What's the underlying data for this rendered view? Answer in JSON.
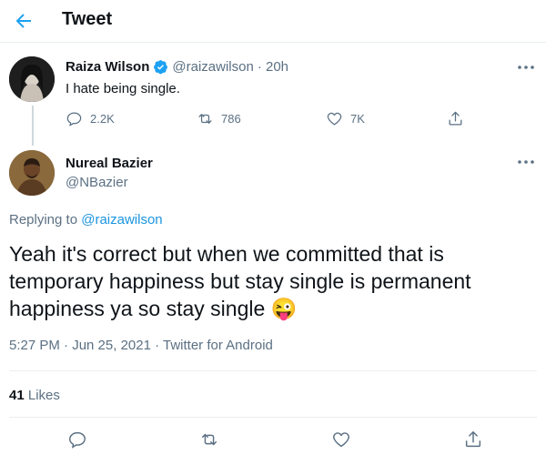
{
  "header": {
    "title": "Tweet"
  },
  "parent_tweet": {
    "name": "Raiza Wilson",
    "handle": "@raizawilson",
    "time": "· 20h",
    "text": "I hate being single.",
    "reply_count": "2.2K",
    "retweet_count": "786",
    "like_count": "7K"
  },
  "main_tweet": {
    "name": "Nureal Bazier",
    "handle": "@NBazier",
    "replying_label": "Replying to",
    "replying_handle": "@raizawilson",
    "text": "Yeah it's correct but when we committed that is temporary happiness but stay single is permanent happiness ya so stay single",
    "emoji": "😜",
    "meta": "5:27 PM · Jun 25, 2021 · Twitter for Android",
    "likes_count": "41",
    "likes_label": "Likes"
  },
  "colors": {
    "accent": "#1da1f2",
    "verified": "#1da1f2",
    "grey": "#5b7083"
  }
}
